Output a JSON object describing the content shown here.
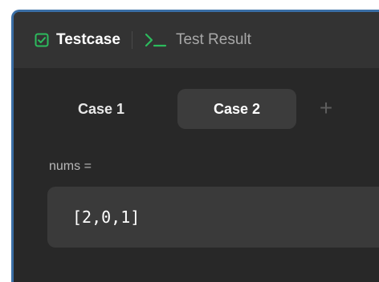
{
  "tabs": {
    "testcase_label": "Testcase",
    "test_result_label": "Test Result",
    "testcase_icon": "checkbox-icon",
    "test_result_icon": "terminal-icon"
  },
  "cases": {
    "items": [
      {
        "label": "Case 1",
        "selected": false
      },
      {
        "label": "Case 2",
        "selected": true
      }
    ],
    "add_label": "+"
  },
  "params": [
    {
      "name": "nums =",
      "value": "[2,0,1]"
    }
  ],
  "colors": {
    "panel_bg": "#282828",
    "header_bg": "#333333",
    "accent_green": "#2cbb5d",
    "selected_case_bg": "#3c3c3c",
    "value_box_bg": "#3a3a3a"
  }
}
